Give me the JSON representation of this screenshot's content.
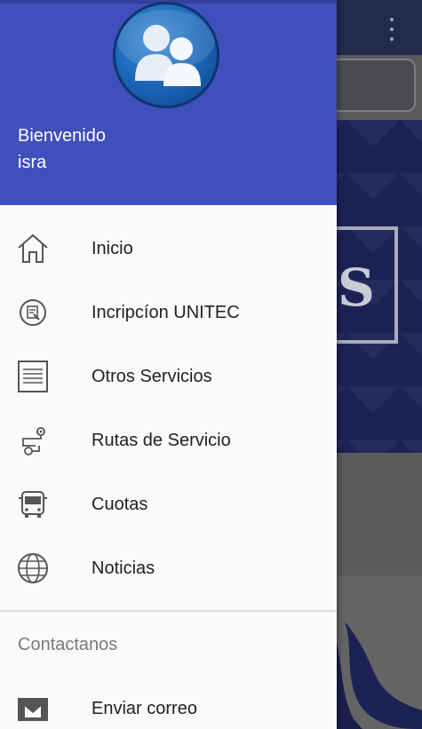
{
  "drawer": {
    "greeting_line1": "Bienvenido",
    "greeting_line2": "isra",
    "items": [
      {
        "label": "Inicio",
        "icon": "home-icon"
      },
      {
        "label": "Incripcíon UNITEC",
        "icon": "registration-icon"
      },
      {
        "label": "Otros Servicios",
        "icon": "document-icon"
      },
      {
        "label": "Rutas de Servicio",
        "icon": "route-icon"
      },
      {
        "label": "Cuotas",
        "icon": "bus-icon"
      },
      {
        "label": "Noticias",
        "icon": "globe-icon"
      }
    ],
    "section_title": "Contactanos",
    "contact_items": [
      {
        "label": "Enviar correo",
        "icon": "mail-icon"
      }
    ]
  },
  "colors": {
    "header": "#3f4fbb",
    "drawer_bg": "#fafafa",
    "text": "#212121",
    "section_text": "#7a7a7a"
  }
}
